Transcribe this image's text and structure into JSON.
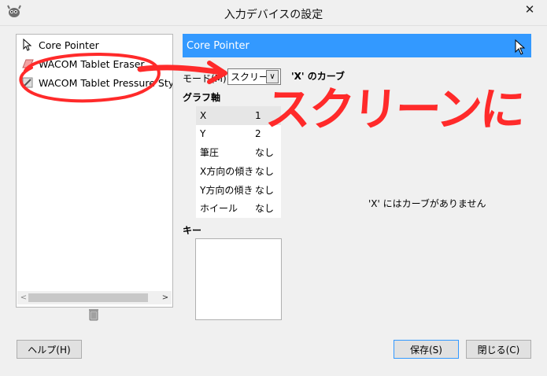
{
  "window": {
    "title": "入力デバイスの設定",
    "close_glyph": "✕"
  },
  "devices": [
    {
      "label": "Core Pointer",
      "icon": "pointer-icon"
    },
    {
      "label": "WACOM Tablet Eraser",
      "icon": "eraser-icon"
    },
    {
      "label": "WACOM Tablet Pressure Stylus",
      "icon": "stylus-icon"
    }
  ],
  "device_header": "Core Pointer",
  "mode": {
    "label": "モード(M):",
    "value": "スクリーン"
  },
  "curve_title": "'X' のカーブ",
  "axes": {
    "title": "グラフ軸",
    "rows": [
      {
        "name": "X",
        "value": "1"
      },
      {
        "name": "Y",
        "value": "2"
      },
      {
        "name": "筆圧",
        "value": "なし"
      },
      {
        "name": "X方向の傾き",
        "value": "なし"
      },
      {
        "name": "Y方向の傾き",
        "value": "なし"
      },
      {
        "name": "ホイール",
        "value": "なし"
      }
    ]
  },
  "keys_title": "キー",
  "no_curve_text": "'X' にはカーブがありません",
  "buttons": {
    "help": "ヘルプ(H)",
    "save": "保存(S)",
    "close": "閉じる(C)"
  },
  "annotation": {
    "text": "スクリーンに",
    "color": "#ff2a2a"
  },
  "colors": {
    "accent": "#3399ff",
    "annotation": "#ff2a2a"
  }
}
